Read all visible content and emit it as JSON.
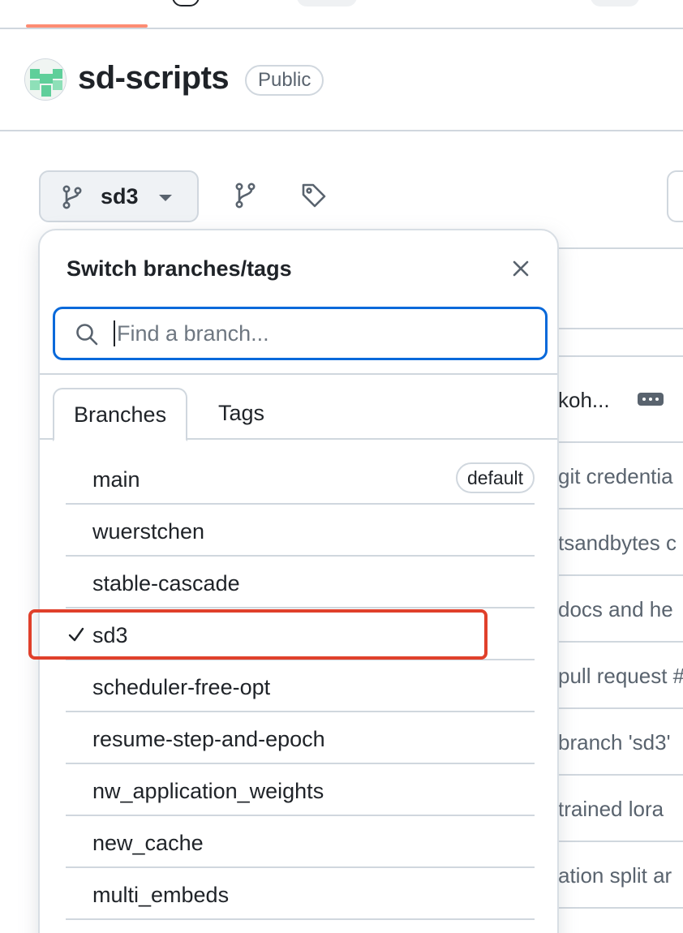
{
  "repo": {
    "name": "sd-scripts",
    "visibility_badge": "Public"
  },
  "toolbar": {
    "current_branch": "sd3"
  },
  "dropdown": {
    "title": "Switch branches/tags",
    "search_placeholder": "Find a branch...",
    "tabs": [
      {
        "label": "Branches",
        "active": true
      },
      {
        "label": "Tags",
        "active": false
      }
    ],
    "branches": [
      {
        "name": "main",
        "badge": "default",
        "selected": false
      },
      {
        "name": "wuerstchen",
        "badge": "",
        "selected": false
      },
      {
        "name": "stable-cascade",
        "badge": "",
        "selected": false
      },
      {
        "name": "sd3",
        "badge": "",
        "selected": true
      },
      {
        "name": "scheduler-free-opt",
        "badge": "",
        "selected": false
      },
      {
        "name": "resume-step-and-epoch",
        "badge": "",
        "selected": false
      },
      {
        "name": "nw_application_weights",
        "badge": "",
        "selected": false
      },
      {
        "name": "new_cache",
        "badge": "",
        "selected": false
      },
      {
        "name": "multi_embeds",
        "badge": "",
        "selected": false
      }
    ]
  },
  "background": {
    "commit_author_fragment": "koh...",
    "commit_messages": [
      "git credentia",
      "tsandbytes c",
      "docs and he",
      "pull request #",
      "branch 'sd3'",
      "trained lora",
      "ation split ar"
    ]
  },
  "colors": {
    "accent_blue": "#0969da",
    "highlight_red": "#e0402b",
    "tab_underline": "#fd8c73",
    "border": "#d0d7de"
  },
  "icons": [
    "git-branch-icon",
    "caret-down-icon",
    "branches-icon",
    "tag-icon",
    "close-icon",
    "search-icon",
    "check-icon",
    "kebab-icon"
  ]
}
